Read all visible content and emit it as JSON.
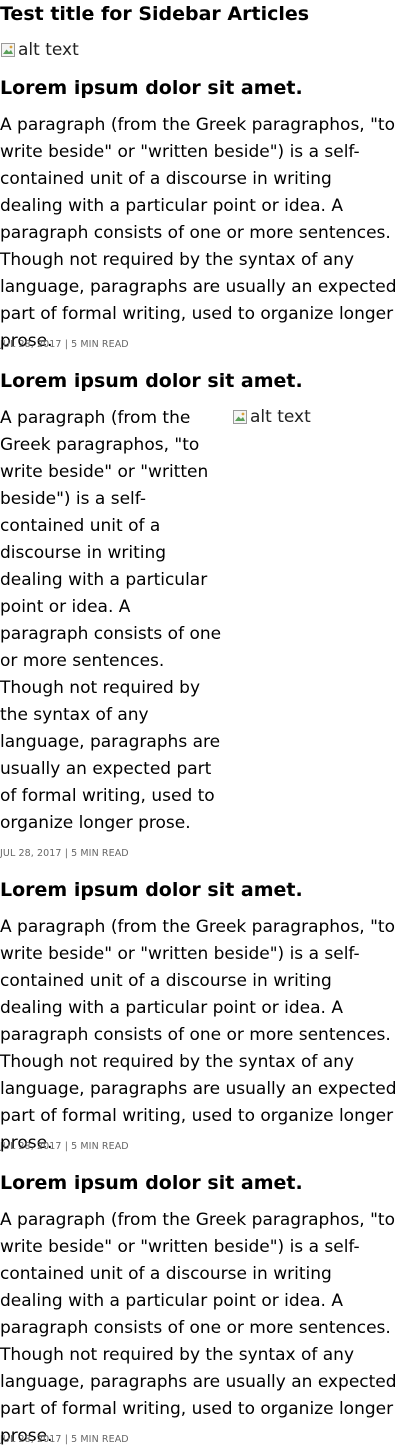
{
  "sidebar": {
    "title": "Test title for Sidebar Articles",
    "top_image_alt": "alt text",
    "articles": [
      {
        "title": "Lorem ipsum dolor sit amet.",
        "body": "A paragraph (from the Greek paragraphos, \"to write beside\" or \"written beside\") is a self-contained unit of a discourse in writing dealing with a particular point or idea. A paragraph consists of one or more sentences. Though not required by the syntax of any language, paragraphs are usually an expected part of formal writing, used to organize longer prose.",
        "meta": "JUL 28, 2017 | 5 MIN READ"
      },
      {
        "title": "Lorem ipsum dolor sit amet.",
        "body": "A paragraph (from the Greek paragraphos, \"to write beside\" or \"written beside\") is a self-contained unit of a discourse in writing dealing with a particular point or idea. A paragraph consists of one or more sentences. Though not required by the syntax of any language, paragraphs are usually an expected part of formal writing, used to organize longer prose.",
        "meta": "JUL 28, 2017 | 5 MIN READ",
        "image_alt": "alt text"
      },
      {
        "title": "Lorem ipsum dolor sit amet.",
        "body": "A paragraph (from the Greek paragraphos, \"to write beside\" or \"written beside\") is a self-contained unit of a discourse in writing dealing with a particular point or idea. A paragraph consists of one or more sentences. Though not required by the syntax of any language, paragraphs are usually an expected part of formal writing, used to organize longer prose.",
        "meta": "JUL 28, 2017 | 5 MIN READ"
      },
      {
        "title": "Lorem ipsum dolor sit amet.",
        "body": "A paragraph (from the Greek paragraphos, \"to write beside\" or \"written beside\") is a self-contained unit of a discourse in writing dealing with a particular point or idea. A paragraph consists of one or more sentences. Though not required by the syntax of any language, paragraphs are usually an expected part of formal writing, used to organize longer prose.",
        "meta": "JUL 28, 2017 | 5 MIN READ"
      }
    ]
  }
}
